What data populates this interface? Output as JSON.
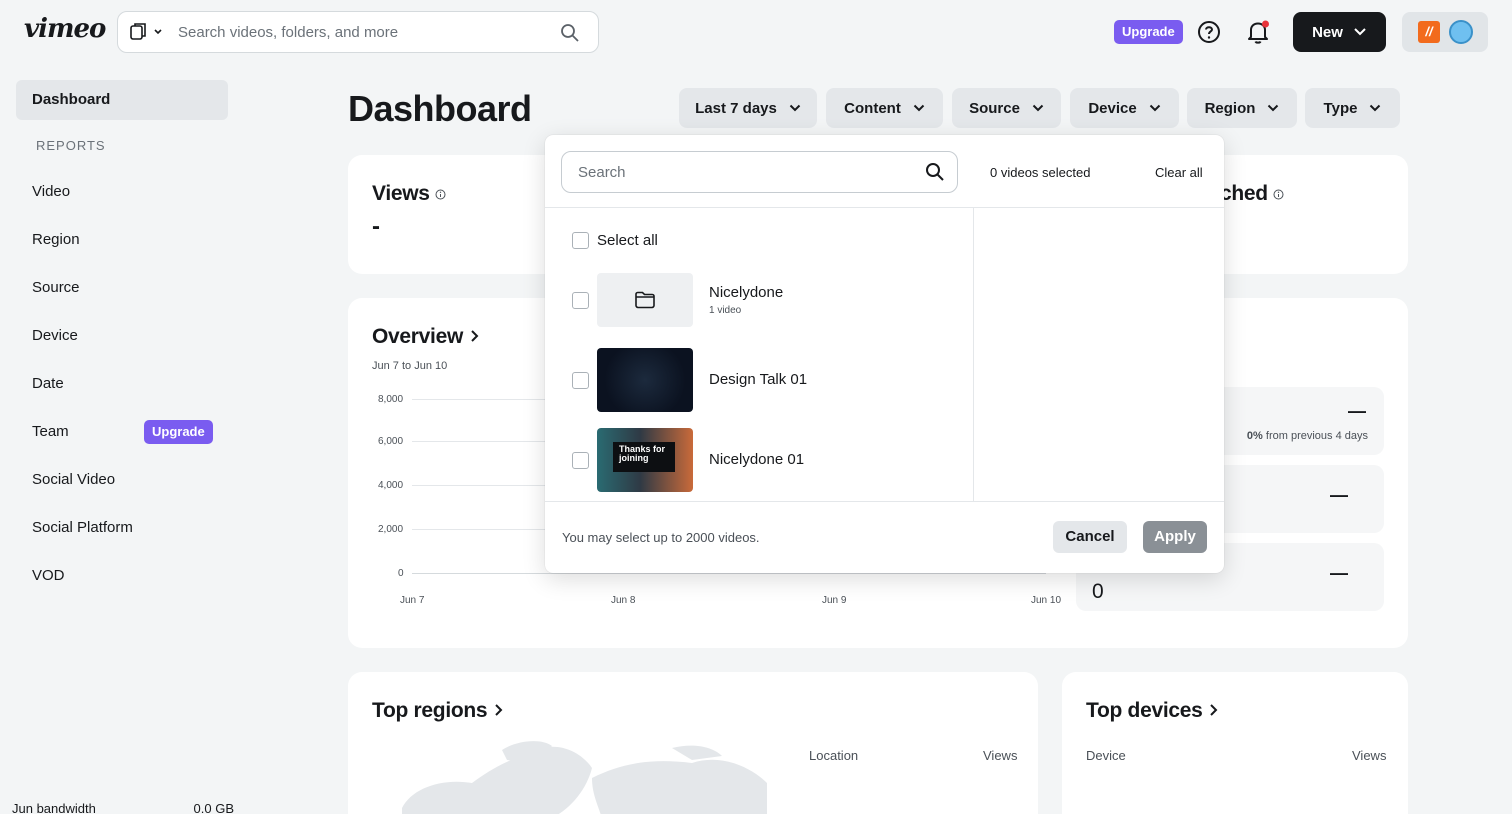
{
  "header": {
    "logo": "vimeo",
    "search_placeholder": "Search videos, folders, and more",
    "upgrade_label": "Upgrade",
    "new_label": "New",
    "brand_letter": "//"
  },
  "sidebar": {
    "active": "Dashboard",
    "section_label": "REPORTS",
    "items": [
      "Video",
      "Region",
      "Source",
      "Device",
      "Date",
      "Team",
      "Social Video",
      "Social Platform",
      "VOD"
    ],
    "team_upgrade": "Upgrade",
    "bandwidth_label": "Jun bandwidth",
    "bandwidth_value": "0.0 GB"
  },
  "main": {
    "title": "Dashboard",
    "filters": [
      "Last 7 days",
      "Content",
      "Source",
      "Device",
      "Region",
      "Type"
    ],
    "views_title": "Views",
    "views_value": "-",
    "watched_title_partial": "ched",
    "overview_title": "Overview",
    "overview_range": "Jun 7 to Jun 10",
    "stat_dash": "—",
    "stat_change_pct": "0%",
    "stat_change_text": "from previous 4 days",
    "stat_zero": "0",
    "top_regions_title": "Top regions",
    "regions_cols": [
      "Location",
      "Views"
    ],
    "top_devices_title": "Top devices",
    "devices_cols": [
      "Device",
      "Views"
    ]
  },
  "chart_data": {
    "type": "line",
    "x": [
      "Jun 7",
      "Jun 8",
      "Jun 9",
      "Jun 10"
    ],
    "series": [],
    "y_ticks": [
      "8,000",
      "6,000",
      "4,000",
      "2,000",
      "0"
    ],
    "ylim": [
      0,
      8000
    ],
    "grid": true
  },
  "modal": {
    "search_placeholder": "Search",
    "selected_count": "0 videos selected",
    "clear_all": "Clear all",
    "select_all": "Select all",
    "items": [
      {
        "name": "Nicelydone",
        "sub": "1 video",
        "kind": "folder"
      },
      {
        "name": "Design Talk 01",
        "sub": "",
        "kind": "video"
      },
      {
        "name": "Nicelydone 01",
        "sub": "",
        "kind": "video"
      }
    ],
    "thumb_text": "Thanks for joining",
    "footer_note": "You may select up to 2000 videos.",
    "cancel": "Cancel",
    "apply": "Apply"
  },
  "colors": {
    "accent_purple": "#7a5cf0",
    "dark": "#17191c",
    "bg": "#f3f5f6",
    "apply_disabled": "#8a9096",
    "notification_dot": "#e8333a"
  }
}
